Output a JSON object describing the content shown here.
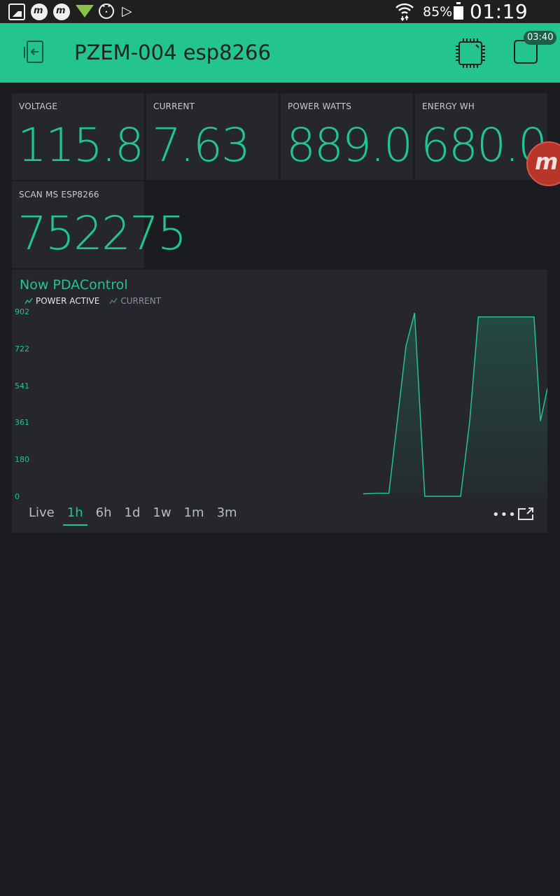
{
  "status_bar": {
    "battery_percent": "85%",
    "time": "01:19 PM",
    "icons": [
      "gallery-icon",
      "m-app-icon",
      "m-app-icon-2",
      "download-triangle-icon",
      "dots-circle-icon",
      "play-store-icon",
      "wifi-icon",
      "battery-icon"
    ]
  },
  "header": {
    "title": "PZEM-004 esp8266",
    "badge": "03:40",
    "accent": "#23c48e"
  },
  "tiles": [
    {
      "label": "VOLTAGE",
      "value": "115.8"
    },
    {
      "label": "CURRENT",
      "value": "7.63"
    },
    {
      "label": "POWER WATTS",
      "value": "889.0"
    },
    {
      "label": "ENERGY WH",
      "value": "680.0"
    },
    {
      "label": "SCAN MS ESP8266",
      "value": "752275"
    }
  ],
  "chart": {
    "title": "Now PDAControl",
    "legend": [
      "POWER ACTIVE",
      "CURRENT"
    ],
    "ranges": [
      "Live",
      "1h",
      "6h",
      "1d",
      "1w",
      "1m",
      "3m"
    ],
    "active_range": "1h",
    "more_label": "•••"
  },
  "chart_data": {
    "type": "area",
    "series": [
      {
        "name": "POWER ACTIVE",
        "x": [
          0.0,
          0.656,
          0.681,
          0.704,
          0.736,
          0.752,
          0.771,
          0.838,
          0.855,
          0.871,
          0.969,
          0.975,
          0.987,
          1.0
        ],
        "values": [
          0,
          12,
          15,
          15,
          740,
          902,
          0,
          0,
          370,
          882,
          882,
          882,
          370,
          530
        ]
      }
    ],
    "x_start_fraction": 0.656,
    "yticks": [
      "902",
      "722",
      "541",
      "361",
      "180",
      "0"
    ],
    "ylim": [
      0,
      902
    ],
    "grid": false
  }
}
